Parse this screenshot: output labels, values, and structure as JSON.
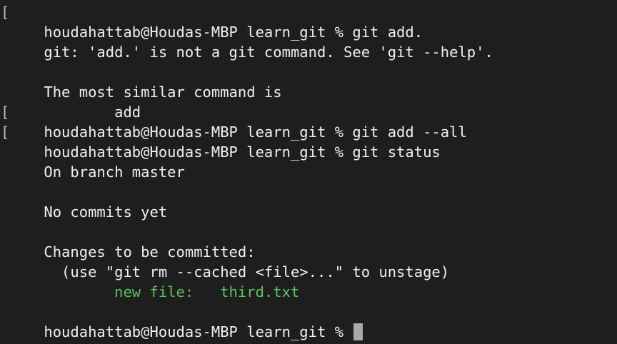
{
  "terminal": {
    "lines": [
      {
        "kind": "prompt",
        "text": "houdahattab@Houdas-MBP learn_git % git add.",
        "bracket": "["
      },
      {
        "kind": "output",
        "text": "git: 'add.' is not a git command. See 'git --help'."
      },
      {
        "kind": "blank",
        "text": ""
      },
      {
        "kind": "output",
        "text": "The most similar command is"
      },
      {
        "kind": "output",
        "text": "        add"
      },
      {
        "kind": "prompt",
        "text": "houdahattab@Houdas-MBP learn_git % git add --all",
        "bracket": "["
      },
      {
        "kind": "prompt",
        "text": "houdahattab@Houdas-MBP learn_git % git status",
        "bracket": "["
      },
      {
        "kind": "output",
        "text": "On branch master"
      },
      {
        "kind": "blank",
        "text": ""
      },
      {
        "kind": "output",
        "text": "No commits yet"
      },
      {
        "kind": "blank",
        "text": ""
      },
      {
        "kind": "output",
        "text": "Changes to be committed:"
      },
      {
        "kind": "output",
        "text": "  (use \"git rm --cached <file>...\" to unstage)"
      },
      {
        "kind": "staged",
        "text": "        new file:   third.txt"
      },
      {
        "kind": "blank",
        "text": ""
      },
      {
        "kind": "prompt",
        "text": "houdahattab@Houdas-MBP learn_git % "
      }
    ],
    "colors": {
      "background": "#1e1e1e",
      "foreground": "#f0f0f0",
      "staged": "#5ac45a",
      "cursor": "#a8a8a8"
    }
  }
}
